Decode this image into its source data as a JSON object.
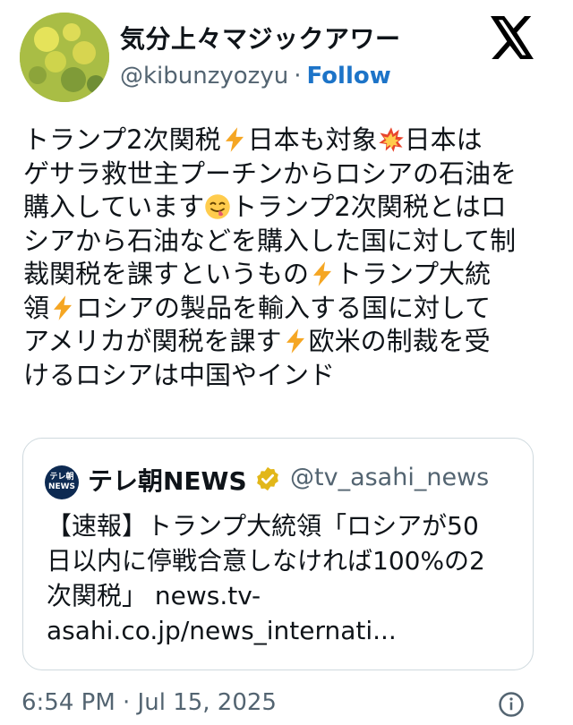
{
  "author": {
    "display_name": "気分上々マジックアワー",
    "handle": "@kibunzyozyu",
    "separator": "·",
    "follow_label": "Follow"
  },
  "tweet": {
    "lines": [
      [
        "トランプ2次関税",
        "bolt",
        "日本も対象",
        "collision",
        "日本は"
      ],
      [
        "ゲサラ救世主プーチンからロシアの石油を"
      ],
      [
        "購入しています",
        "yum",
        "トランプ2次関税とはロ"
      ],
      [
        "シアから石油などを購入した国に対して制"
      ],
      [
        "裁関税を課すというもの",
        "bolt",
        "トランプ大統"
      ],
      [
        "領",
        "bolt",
        "ロシアの製品を輸入する国に対して"
      ],
      [
        "アメリカが関税を課す",
        "bolt",
        "欧米の制裁を受"
      ],
      [
        "けるロシアは中国やインド"
      ]
    ]
  },
  "quote": {
    "avatar_text_top": "テレ朝",
    "avatar_text_bottom": "NEWS",
    "name": "テレ朝NEWS",
    "handle": "@tv_asahi_news",
    "lines": [
      "【速報】トランプ大統領「ロシアが50",
      "日以内に停戦合意しなければ100%の2",
      "次関税」 news.tv-",
      "asahi.co.jp/news_internati..."
    ]
  },
  "footer": {
    "timestamp": "6:54 PM · Jul 15, 2025"
  },
  "colors": {
    "follow": "#1d74c8",
    "secondary_text": "#536471",
    "border": "#cfd9de",
    "verified_gold": "#e2b719"
  },
  "icons": {
    "platform": "x-logo-icon",
    "verified": "verified-badge-icon",
    "info": "info-icon",
    "emoji_bolt": "high-voltage-emoji",
    "emoji_collision": "collision-emoji",
    "emoji_yum": "face-savoring-food-emoji"
  }
}
